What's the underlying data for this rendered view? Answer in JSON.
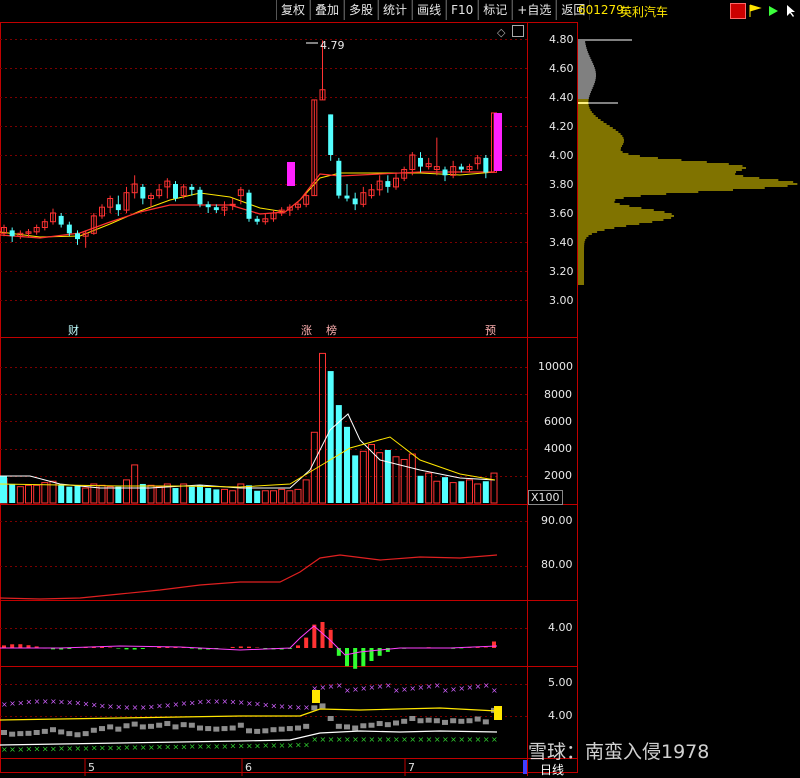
{
  "toolbar": {
    "buttons": [
      "复权",
      "叠加",
      "多股",
      "统计",
      "画线",
      "F10",
      "标记",
      "+自选",
      "返回"
    ]
  },
  "stock": {
    "code": "601279",
    "name": "英利汽车"
  },
  "price_axis": {
    "ticks": [
      "4.80",
      "4.60",
      "4.40",
      "4.20",
      "4.00",
      "3.80",
      "3.60",
      "3.40",
      "3.20",
      "3.00"
    ],
    "high_label": "4.79"
  },
  "volume_axis": {
    "ticks": [
      "10000",
      "8000",
      "6000",
      "4000",
      "2000"
    ],
    "unit": "X100"
  },
  "indicator1_axis": {
    "ticks": [
      "90.00",
      "80.00"
    ]
  },
  "indicator2_axis": {
    "ticks": [
      "4.00"
    ]
  },
  "indicator3_axis": {
    "ticks": [
      "5.00",
      "4.00"
    ]
  },
  "event_markers": [
    "财",
    "涨",
    "榜",
    "预"
  ],
  "x_labels": [
    "5",
    "6",
    "7"
  ],
  "period_label": "日线",
  "watermark": "雪球：南蛮入侵1978",
  "colors": {
    "up": "#ff3333",
    "down": "#54ffff",
    "grid": "#7a0000",
    "axis_text": "#e8e8e8",
    "stock_text": "#ffe600"
  },
  "chart_data": {
    "type": "candlestick",
    "ylim": [
      2.9,
      4.85
    ],
    "candles": [
      [
        3.46,
        3.5,
        3.44,
        3.52
      ],
      [
        3.48,
        3.44,
        3.4,
        3.5
      ],
      [
        3.44,
        3.46,
        3.42,
        3.48
      ],
      [
        3.46,
        3.47,
        3.43,
        3.49
      ],
      [
        3.47,
        3.5,
        3.45,
        3.52
      ],
      [
        3.5,
        3.54,
        3.48,
        3.56
      ],
      [
        3.54,
        3.6,
        3.52,
        3.63
      ],
      [
        3.58,
        3.52,
        3.5,
        3.6
      ],
      [
        3.52,
        3.46,
        3.44,
        3.54
      ],
      [
        3.46,
        3.42,
        3.38,
        3.48
      ],
      [
        3.44,
        3.46,
        3.36,
        3.48
      ],
      [
        3.46,
        3.58,
        3.45,
        3.6
      ],
      [
        3.58,
        3.64,
        3.56,
        3.66
      ],
      [
        3.64,
        3.7,
        3.6,
        3.72
      ],
      [
        3.66,
        3.62,
        3.58,
        3.72
      ],
      [
        3.62,
        3.74,
        3.6,
        3.78
      ],
      [
        3.74,
        3.8,
        3.7,
        3.86
      ],
      [
        3.78,
        3.7,
        3.66,
        3.8
      ],
      [
        3.7,
        3.72,
        3.64,
        3.74
      ],
      [
        3.72,
        3.76,
        3.7,
        3.8
      ],
      [
        3.78,
        3.82,
        3.7,
        3.84
      ],
      [
        3.8,
        3.7,
        3.68,
        3.82
      ],
      [
        3.72,
        3.78,
        3.7,
        3.8
      ],
      [
        3.78,
        3.76,
        3.72,
        3.8
      ],
      [
        3.76,
        3.66,
        3.64,
        3.78
      ],
      [
        3.66,
        3.64,
        3.6,
        3.68
      ],
      [
        3.64,
        3.62,
        3.6,
        3.66
      ],
      [
        3.62,
        3.64,
        3.58,
        3.68
      ],
      [
        3.66,
        3.66,
        3.62,
        3.7
      ],
      [
        3.72,
        3.76,
        3.66,
        3.78
      ],
      [
        3.74,
        3.56,
        3.54,
        3.76
      ],
      [
        3.56,
        3.54,
        3.52,
        3.58
      ],
      [
        3.54,
        3.56,
        3.52,
        3.6
      ],
      [
        3.56,
        3.6,
        3.54,
        3.62
      ],
      [
        3.6,
        3.62,
        3.58,
        3.64
      ],
      [
        3.62,
        3.64,
        3.58,
        3.66
      ],
      [
        3.64,
        3.66,
        3.62,
        3.68
      ],
      [
        3.66,
        3.72,
        3.64,
        3.74
      ],
      [
        3.72,
        4.38,
        3.72,
        4.38
      ],
      [
        4.38,
        4.45,
        4.38,
        4.79
      ],
      [
        4.28,
        4.0,
        3.96,
        4.28
      ],
      [
        3.96,
        3.72,
        3.7,
        3.98
      ],
      [
        3.72,
        3.7,
        3.68,
        3.8
      ],
      [
        3.7,
        3.66,
        3.62,
        3.74
      ],
      [
        3.66,
        3.74,
        3.64,
        3.78
      ],
      [
        3.72,
        3.76,
        3.7,
        3.8
      ],
      [
        3.76,
        3.82,
        3.72,
        3.86
      ],
      [
        3.82,
        3.78,
        3.74,
        3.86
      ],
      [
        3.78,
        3.84,
        3.76,
        3.88
      ],
      [
        3.84,
        3.9,
        3.82,
        3.92
      ],
      [
        3.9,
        4.0,
        3.86,
        4.02
      ],
      [
        3.98,
        3.92,
        3.88,
        4.02
      ],
      [
        3.92,
        3.94,
        3.9,
        3.98
      ],
      [
        3.9,
        3.92,
        3.86,
        4.12
      ],
      [
        3.9,
        3.86,
        3.82,
        3.92
      ],
      [
        3.86,
        3.92,
        3.84,
        3.96
      ],
      [
        3.92,
        3.9,
        3.88,
        3.94
      ],
      [
        3.9,
        3.92,
        3.88,
        3.94
      ],
      [
        3.94,
        3.98,
        3.9,
        4.0
      ],
      [
        3.98,
        3.88,
        3.84,
        4.0
      ],
      [
        3.88,
        4.29,
        3.88,
        4.29
      ]
    ]
  }
}
